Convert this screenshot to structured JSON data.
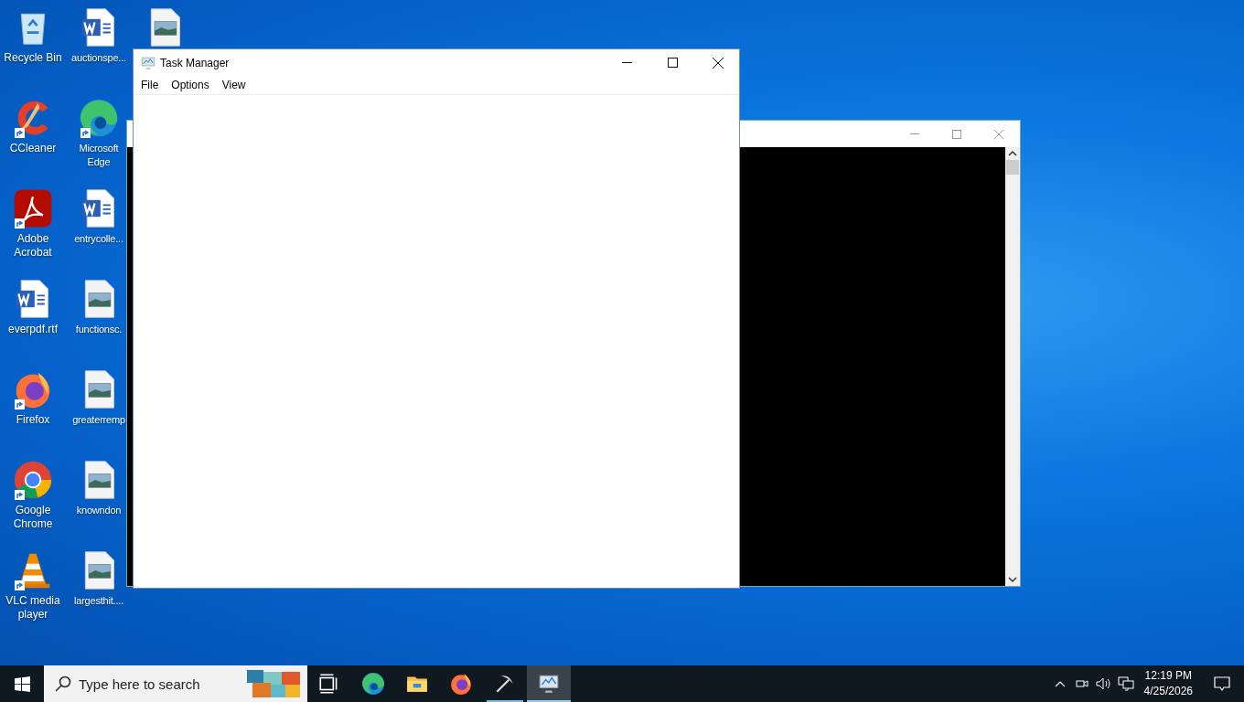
{
  "desktop_icons": [
    {
      "label": "Recycle Bin",
      "kind": "recycle",
      "shortcut": false
    },
    {
      "label": "CCleaner",
      "kind": "ccleaner",
      "shortcut": true
    },
    {
      "label": "Adobe Acrobat",
      "kind": "acrobat",
      "shortcut": true
    },
    {
      "label": "everpdf.rtf",
      "kind": "word",
      "shortcut": false
    },
    {
      "label": "Firefox",
      "kind": "firefox",
      "shortcut": true
    },
    {
      "label": "Google Chrome",
      "kind": "chrome",
      "shortcut": true
    },
    {
      "label": "VLC media player",
      "kind": "vlc",
      "shortcut": true
    },
    {
      "label": "auctionspe...",
      "kind": "word",
      "shortcut": false
    },
    {
      "label": "Microsoft Edge",
      "kind": "edge",
      "shortcut": true
    },
    {
      "label": "entrycolle...",
      "kind": "word",
      "shortcut": false
    },
    {
      "label": "functionsc.",
      "kind": "image",
      "shortcut": false
    },
    {
      "label": "greaterremp",
      "kind": "image",
      "shortcut": false
    },
    {
      "label": "knowndon",
      "kind": "image",
      "shortcut": false
    },
    {
      "label": "largesthit....",
      "kind": "image",
      "shortcut": false
    },
    {
      "kind": "image",
      "shortcut": false
    }
  ],
  "task_manager": {
    "title": "Task Manager",
    "menu": [
      "File",
      "Options",
      "View"
    ]
  },
  "taskbar": {
    "search": {
      "placeholder": "Type here to search"
    },
    "apps": [
      {
        "kind": "taskview",
        "running": false,
        "active": false
      },
      {
        "kind": "edge",
        "running": false,
        "active": false
      },
      {
        "kind": "explorer",
        "running": false,
        "active": false
      },
      {
        "kind": "firefox",
        "running": false,
        "active": false
      },
      {
        "kind": "pickaxe",
        "running": true,
        "active": false
      },
      {
        "kind": "taskmanager",
        "running": true,
        "active": true
      }
    ],
    "clock": {
      "time": "12:19 PM",
      "date": "4/25/2026"
    }
  }
}
